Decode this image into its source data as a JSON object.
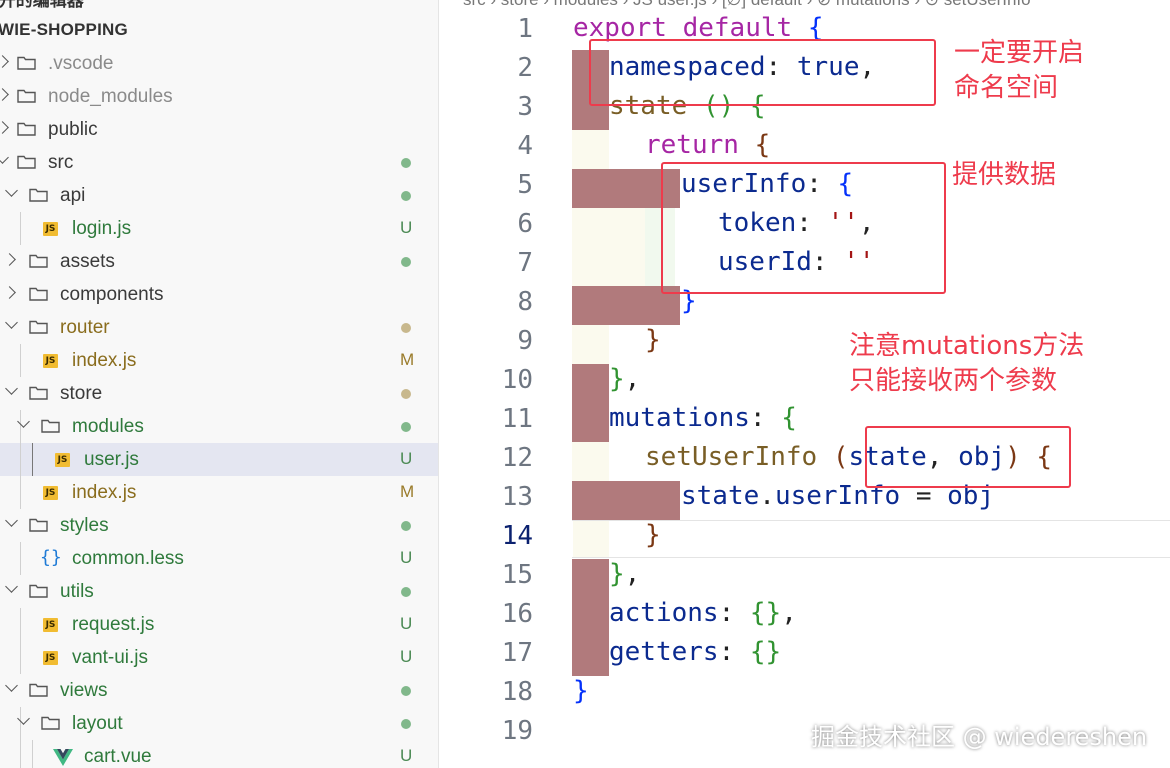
{
  "sidebar": {
    "editor_title": "I开的编辑器",
    "project_name": "WIE-SHOPPING",
    "items": [
      {
        "label": ".vscode",
        "status": ""
      },
      {
        "label": "node_modules",
        "status": ""
      },
      {
        "label": "public",
        "status": ""
      },
      {
        "label": "src",
        "status": "dot"
      },
      {
        "label": "api",
        "status": "dot"
      },
      {
        "label": "login.js",
        "status": "U"
      },
      {
        "label": "assets",
        "status": "dot"
      },
      {
        "label": "components",
        "status": ""
      },
      {
        "label": "router",
        "status": "dot"
      },
      {
        "label": "index.js",
        "status": "M"
      },
      {
        "label": "store",
        "status": "dot"
      },
      {
        "label": "modules",
        "status": "dot"
      },
      {
        "label": "user.js",
        "status": "U"
      },
      {
        "label": "index.js",
        "status": "M"
      },
      {
        "label": "styles",
        "status": "dot"
      },
      {
        "label": "common.less",
        "status": "U"
      },
      {
        "label": "utils",
        "status": "dot"
      },
      {
        "label": "request.js",
        "status": "U"
      },
      {
        "label": "vant-ui.js",
        "status": "U"
      },
      {
        "label": "views",
        "status": "dot"
      },
      {
        "label": "layout",
        "status": "dot"
      },
      {
        "label": "cart.vue",
        "status": "U"
      }
    ]
  },
  "icons": {
    "js_badge": "JS",
    "brace": "{}"
  },
  "breadcrumb": "src › store › modules › JS user.js › [∅] default › ⊘ mutations › ⊙ setUserInfo",
  "editor": {
    "line_numbers": [
      "1",
      "2",
      "3",
      "4",
      "5",
      "6",
      "7",
      "8",
      "9",
      "10",
      "11",
      "12",
      "13",
      "14",
      "15",
      "16",
      "17",
      "18",
      "19"
    ],
    "current_line": "14"
  },
  "code": {
    "l1": {
      "export": "export",
      "default": "default",
      "brace": "{"
    },
    "l2": {
      "namespaced": "namespaced",
      "colon": ":",
      "true": "true",
      "comma": ","
    },
    "l3": {
      "state": "state",
      "paren": "()",
      "brace": "{"
    },
    "l4": {
      "return": "return",
      "brace": "{"
    },
    "l5": {
      "userInfo": "userInfo",
      "colon": ":",
      "brace": "{"
    },
    "l6": {
      "token": "token",
      "colon": ":",
      "str": "''",
      "comma": ","
    },
    "l7": {
      "userId": "userId",
      "colon": ":",
      "str": "''"
    },
    "l8": {
      "brace": "}"
    },
    "l9": {
      "brace": "}"
    },
    "l10": {
      "brace": "}",
      "comma": ","
    },
    "l11": {
      "mutations": "mutations",
      "colon": ":",
      "brace": "{"
    },
    "l12": {
      "setUserInfo": "setUserInfo",
      "lparen": "(",
      "state": "state",
      "comma": ",",
      "obj": "obj",
      "rparen": ")",
      "brace": "{"
    },
    "l13": {
      "state": "state",
      "dot": ".",
      "userInfo": "userInfo",
      "eq": "=",
      "obj": "obj"
    },
    "l14": {
      "brace": "}"
    },
    "l15": {
      "brace": "}",
      "comma": ","
    },
    "l16": {
      "actions": "actions",
      "colon": ":",
      "braces": "{}",
      "comma": ","
    },
    "l17": {
      "getters": "getters",
      "colon": ":",
      "braces": "{}"
    },
    "l18": {
      "brace": "}"
    }
  },
  "annotations": {
    "namespace_line1": "一定要开启",
    "namespace_line2": "命名空间",
    "data_note": "提供数据",
    "mutation_line1": "注意mutations方法",
    "mutation_line2": "只能接收两个参数"
  },
  "watermark": "掘金技术社区 @ wiedereshen",
  "colors": {
    "annotation_red": "#ee3b4c",
    "diff_bar": "#b17a7c",
    "keyword": "#a626a4",
    "identifier": "#0b2a8f",
    "function_name": "#795e26",
    "string": "#a31515"
  }
}
